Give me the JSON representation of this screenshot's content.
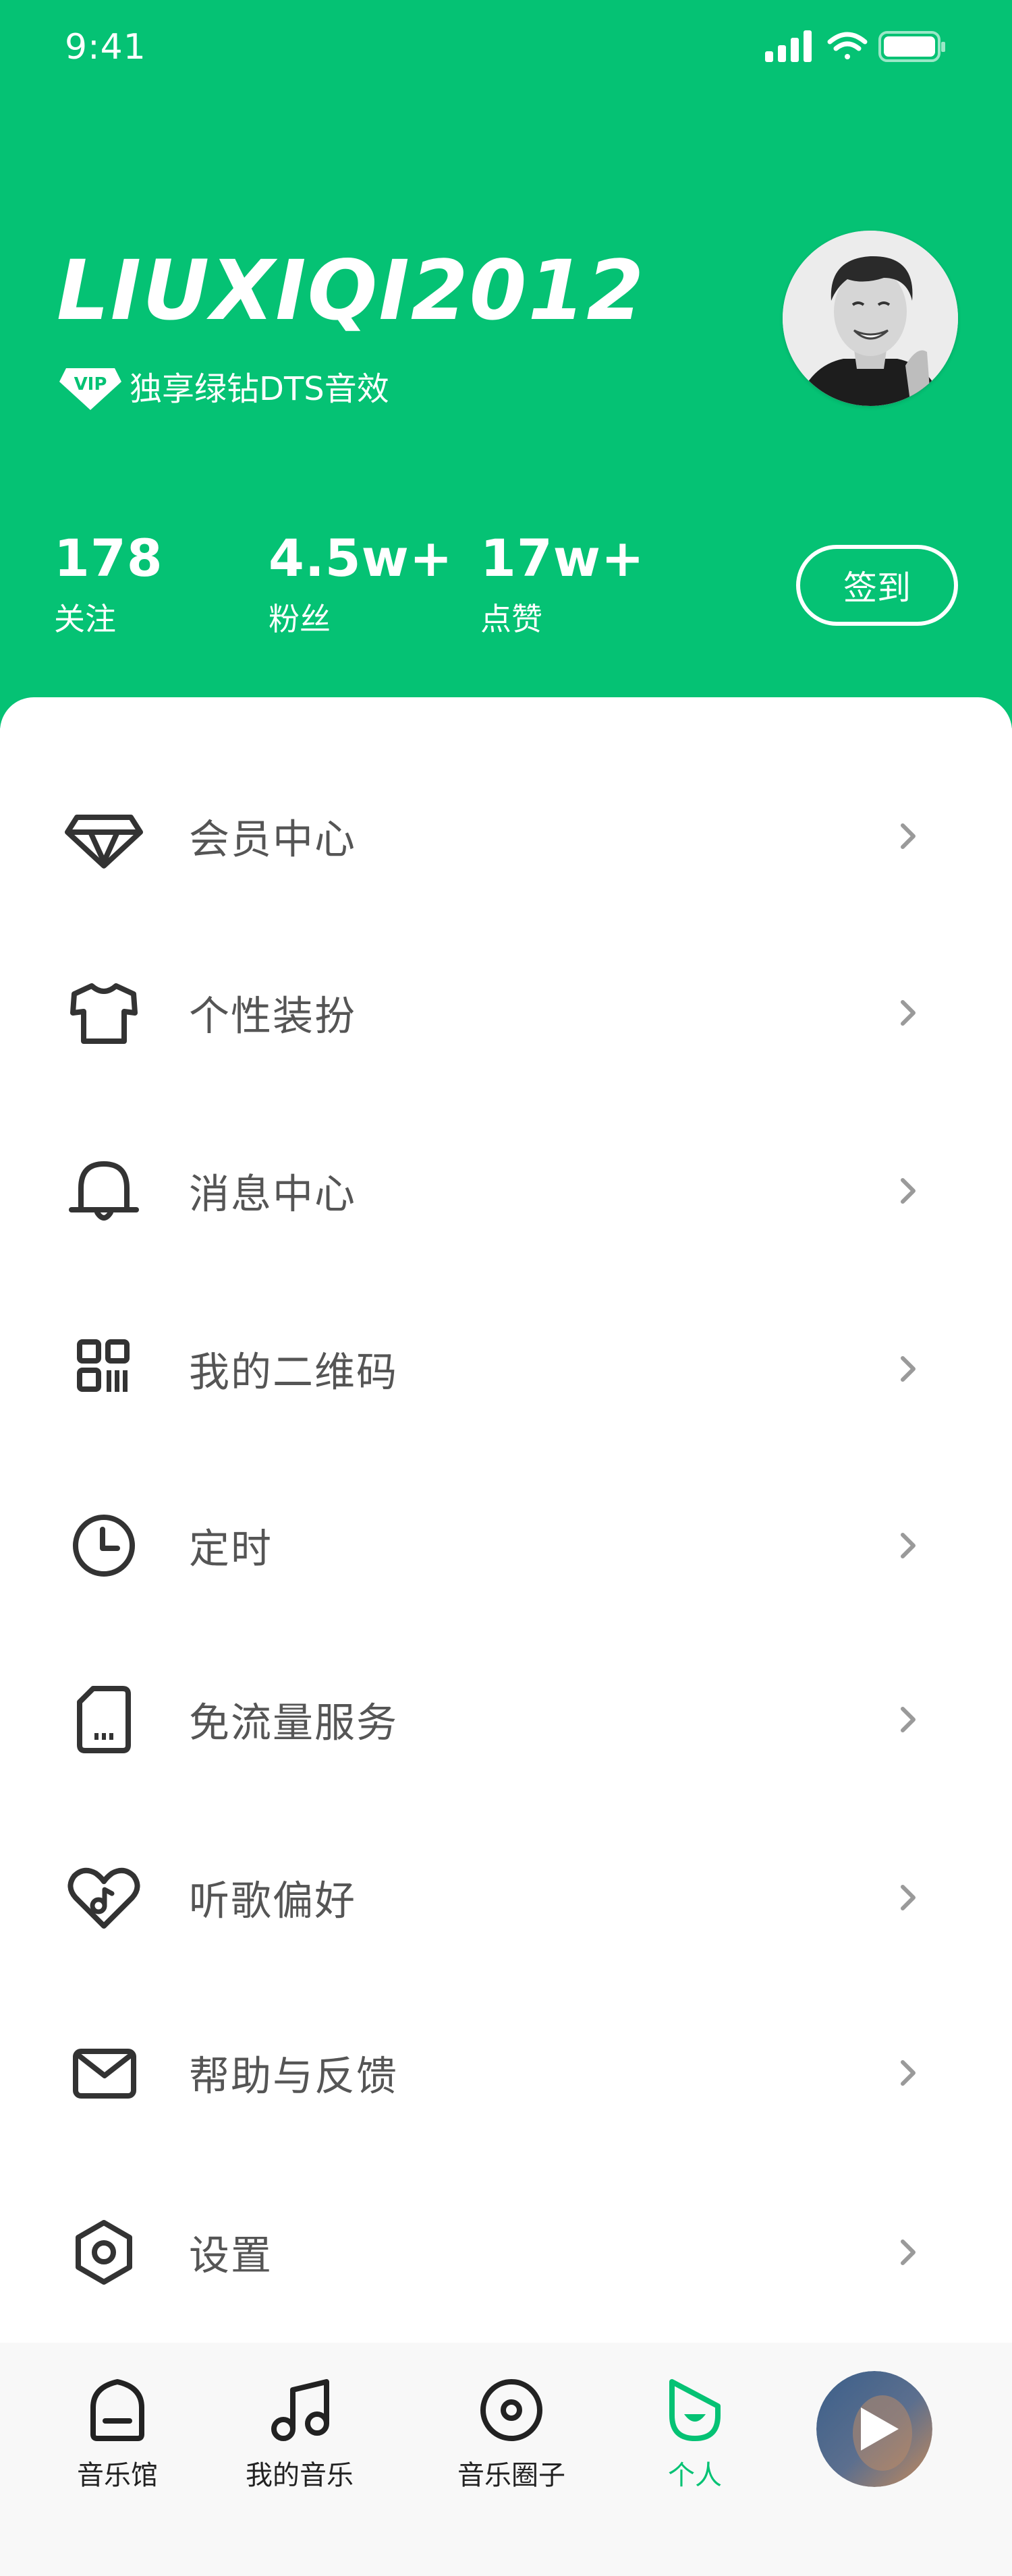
{
  "status_bar": {
    "time": "9:41"
  },
  "profile": {
    "username": "LIUXIQI2012",
    "vip_badge_text": "VIP",
    "vip_description": "独享绿钻DTS音效"
  },
  "stats": [
    {
      "value": "178",
      "label": "关注"
    },
    {
      "value": "4.5w+",
      "label": "粉丝"
    },
    {
      "value": "17w+",
      "label": "点赞"
    }
  ],
  "checkin_label": "签到",
  "menu": [
    {
      "label": "会员中心",
      "icon": "diamond-icon"
    },
    {
      "label": "个性装扮",
      "icon": "tshirt-icon"
    },
    {
      "label": "消息中心",
      "icon": "bell-icon"
    },
    {
      "label": "我的二维码",
      "icon": "qrcode-icon"
    },
    {
      "label": "定时",
      "icon": "clock-icon"
    },
    {
      "label": "免流量服务",
      "icon": "sim-card-icon"
    },
    {
      "label": "听歌偏好",
      "icon": "heart-music-icon"
    },
    {
      "label": "帮助与反馈",
      "icon": "mail-icon"
    },
    {
      "label": "设置",
      "icon": "settings-icon"
    }
  ],
  "tabs": [
    {
      "label": "音乐馆",
      "icon": "music-hall-icon",
      "active": false
    },
    {
      "label": "我的音乐",
      "icon": "music-note-icon",
      "active": false
    },
    {
      "label": "音乐圈子",
      "icon": "disc-icon",
      "active": false
    },
    {
      "label": "个人",
      "icon": "profile-smile-icon",
      "active": true
    }
  ],
  "colors": {
    "brand_green": "#05c274",
    "menu_text": "#555555",
    "icon_stroke": "#333333",
    "chevron": "#9a9a9a"
  }
}
